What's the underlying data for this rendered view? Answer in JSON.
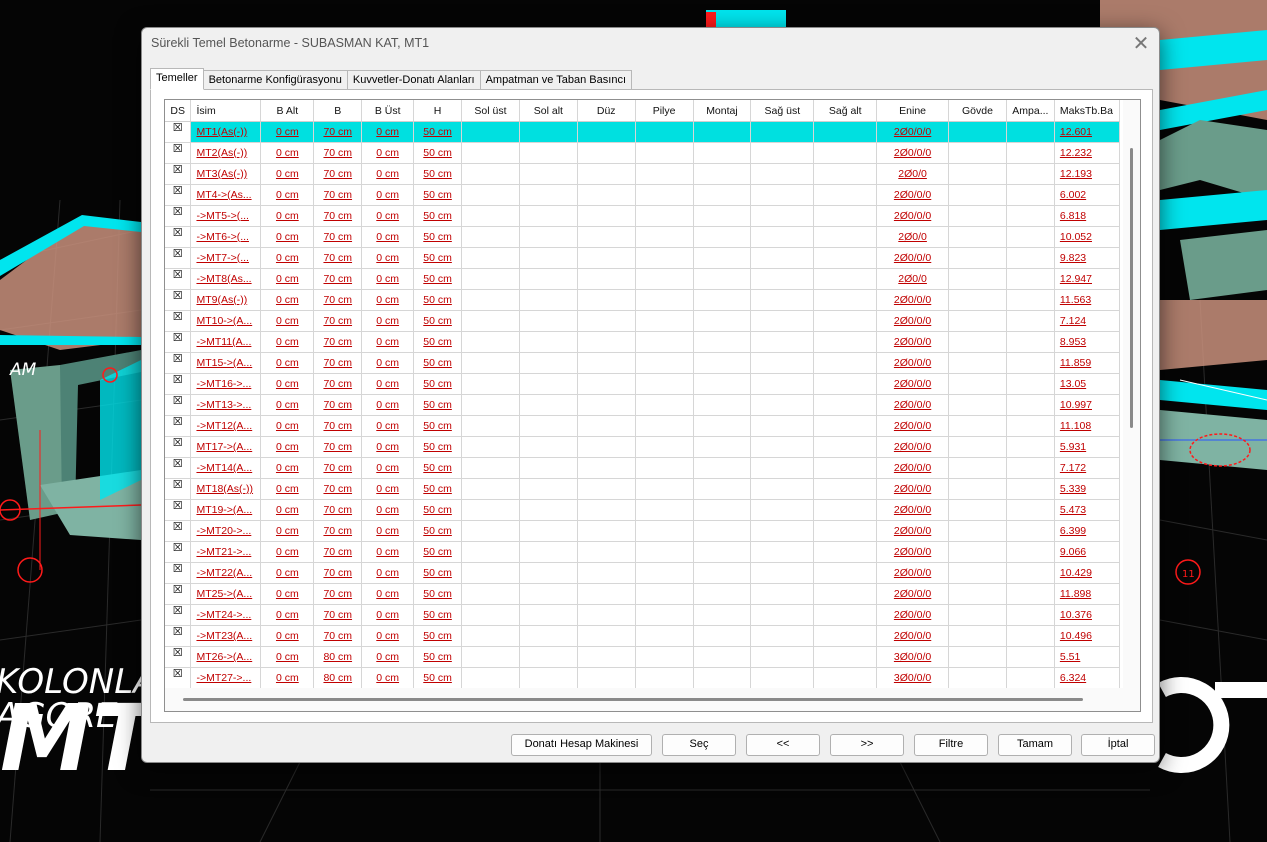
{
  "background": {
    "overlay_text_1": "KOLONLA",
    "overlay_text_2": "AGORE",
    "overlay_text_3": "MT",
    "overlay_text_4": "AM",
    "axis_label_11": "11"
  },
  "dialog": {
    "title": "Sürekli Temel Betonarme - SUBASMAN KAT, MT1",
    "close_glyph": "✕"
  },
  "tabs": [
    {
      "label": "Temeller",
      "active": true
    },
    {
      "label": "Betonarme Konfigürasyonu",
      "active": false
    },
    {
      "label": "Kuvvetler-Donatı Alanları",
      "active": false
    },
    {
      "label": "Ampatman ve Taban Basıncı",
      "active": false
    }
  ],
  "table": {
    "columns": [
      "DS",
      "İsim",
      "B Alt",
      "B",
      "B Üst",
      "H",
      "Sol üst",
      "Sol alt",
      "Düz",
      "Pilye",
      "Montaj",
      "Sağ üst",
      "Sağ alt",
      "Enine",
      "Gövde",
      "Ampa...",
      "MaksTb.Ba"
    ],
    "checkbox_glyph": "☒",
    "selected_row": 0,
    "rows": [
      {
        "isim": "MT1(As(-))",
        "b_alt": "0 cm",
        "b": "70 cm",
        "b_ust": "0 cm",
        "h": "50 cm",
        "enine": "2Ø0/0/0",
        "maks": "12.601"
      },
      {
        "isim": "MT2(As(-))",
        "b_alt": "0 cm",
        "b": "70 cm",
        "b_ust": "0 cm",
        "h": "50 cm",
        "enine": "2Ø0/0/0",
        "maks": "12.232"
      },
      {
        "isim": "MT3(As(-))",
        "b_alt": "0 cm",
        "b": "70 cm",
        "b_ust": "0 cm",
        "h": "50 cm",
        "enine": "2Ø0/0",
        "maks": "12.193"
      },
      {
        "isim": "MT4->(As...",
        "b_alt": "0 cm",
        "b": "70 cm",
        "b_ust": "0 cm",
        "h": "50 cm",
        "enine": "2Ø0/0/0",
        "maks": "6.002"
      },
      {
        "isim": "->MT5->(...",
        "b_alt": "0 cm",
        "b": "70 cm",
        "b_ust": "0 cm",
        "h": "50 cm",
        "enine": "2Ø0/0/0",
        "maks": "6.818"
      },
      {
        "isim": "->MT6->(...",
        "b_alt": "0 cm",
        "b": "70 cm",
        "b_ust": "0 cm",
        "h": "50 cm",
        "enine": "2Ø0/0",
        "maks": "10.052"
      },
      {
        "isim": "->MT7->(...",
        "b_alt": "0 cm",
        "b": "70 cm",
        "b_ust": "0 cm",
        "h": "50 cm",
        "enine": "2Ø0/0/0",
        "maks": "9.823"
      },
      {
        "isim": "->MT8(As...",
        "b_alt": "0 cm",
        "b": "70 cm",
        "b_ust": "0 cm",
        "h": "50 cm",
        "enine": "2Ø0/0",
        "maks": "12.947"
      },
      {
        "isim": "MT9(As(-))",
        "b_alt": "0 cm",
        "b": "70 cm",
        "b_ust": "0 cm",
        "h": "50 cm",
        "enine": "2Ø0/0/0",
        "maks": "11.563"
      },
      {
        "isim": "MT10->(A...",
        "b_alt": "0 cm",
        "b": "70 cm",
        "b_ust": "0 cm",
        "h": "50 cm",
        "enine": "2Ø0/0/0",
        "maks": "7.124"
      },
      {
        "isim": "->MT11(A...",
        "b_alt": "0 cm",
        "b": "70 cm",
        "b_ust": "0 cm",
        "h": "50 cm",
        "enine": "2Ø0/0/0",
        "maks": "8.953"
      },
      {
        "isim": "MT15->(A...",
        "b_alt": "0 cm",
        "b": "70 cm",
        "b_ust": "0 cm",
        "h": "50 cm",
        "enine": "2Ø0/0/0",
        "maks": "11.859"
      },
      {
        "isim": "->MT16->...",
        "b_alt": "0 cm",
        "b": "70 cm",
        "b_ust": "0 cm",
        "h": "50 cm",
        "enine": "2Ø0/0/0",
        "maks": "13.05"
      },
      {
        "isim": "->MT13->...",
        "b_alt": "0 cm",
        "b": "70 cm",
        "b_ust": "0 cm",
        "h": "50 cm",
        "enine": "2Ø0/0/0",
        "maks": "10.997"
      },
      {
        "isim": "->MT12(A...",
        "b_alt": "0 cm",
        "b": "70 cm",
        "b_ust": "0 cm",
        "h": "50 cm",
        "enine": "2Ø0/0/0",
        "maks": "11.108"
      },
      {
        "isim": "MT17->(A...",
        "b_alt": "0 cm",
        "b": "70 cm",
        "b_ust": "0 cm",
        "h": "50 cm",
        "enine": "2Ø0/0/0",
        "maks": "5.931"
      },
      {
        "isim": "->MT14(A...",
        "b_alt": "0 cm",
        "b": "70 cm",
        "b_ust": "0 cm",
        "h": "50 cm",
        "enine": "2Ø0/0/0",
        "maks": "7.172"
      },
      {
        "isim": "MT18(As(-))",
        "b_alt": "0 cm",
        "b": "70 cm",
        "b_ust": "0 cm",
        "h": "50 cm",
        "enine": "2Ø0/0/0",
        "maks": "5.339"
      },
      {
        "isim": "MT19->(A...",
        "b_alt": "0 cm",
        "b": "70 cm",
        "b_ust": "0 cm",
        "h": "50 cm",
        "enine": "2Ø0/0/0",
        "maks": "5.473"
      },
      {
        "isim": "->MT20->...",
        "b_alt": "0 cm",
        "b": "70 cm",
        "b_ust": "0 cm",
        "h": "50 cm",
        "enine": "2Ø0/0/0",
        "maks": "6.399"
      },
      {
        "isim": "->MT21->...",
        "b_alt": "0 cm",
        "b": "70 cm",
        "b_ust": "0 cm",
        "h": "50 cm",
        "enine": "2Ø0/0/0",
        "maks": "9.066"
      },
      {
        "isim": "->MT22(A...",
        "b_alt": "0 cm",
        "b": "70 cm",
        "b_ust": "0 cm",
        "h": "50 cm",
        "enine": "2Ø0/0/0",
        "maks": "10.429"
      },
      {
        "isim": "MT25->(A...",
        "b_alt": "0 cm",
        "b": "70 cm",
        "b_ust": "0 cm",
        "h": "50 cm",
        "enine": "2Ø0/0/0",
        "maks": "11.898"
      },
      {
        "isim": "->MT24->...",
        "b_alt": "0 cm",
        "b": "70 cm",
        "b_ust": "0 cm",
        "h": "50 cm",
        "enine": "2Ø0/0/0",
        "maks": "10.376"
      },
      {
        "isim": "->MT23(A...",
        "b_alt": "0 cm",
        "b": "70 cm",
        "b_ust": "0 cm",
        "h": "50 cm",
        "enine": "2Ø0/0/0",
        "maks": "10.496"
      },
      {
        "isim": "MT26->(A...",
        "b_alt": "0 cm",
        "b": "80 cm",
        "b_ust": "0 cm",
        "h": "50 cm",
        "enine": "3Ø0/0/0",
        "maks": "5.51"
      },
      {
        "isim": "->MT27->...",
        "b_alt": "0 cm",
        "b": "80 cm",
        "b_ust": "0 cm",
        "h": "50 cm",
        "enine": "3Ø0/0/0",
        "maks": "6.324"
      }
    ]
  },
  "buttons": {
    "calculator": "Donatı Hesap Makinesi",
    "select": "Seç",
    "prev": "<<",
    "next": ">>",
    "filter": "Filtre",
    "ok": "Tamam",
    "cancel": "İptal"
  },
  "colors": {
    "selection": "#00e0e0",
    "value_text": "#c00000",
    "cad_beam": "#00e5ee",
    "cad_panel": "#c9907d",
    "cad_column": "#6a9c8a",
    "cad_red": "#ff1a1a"
  }
}
